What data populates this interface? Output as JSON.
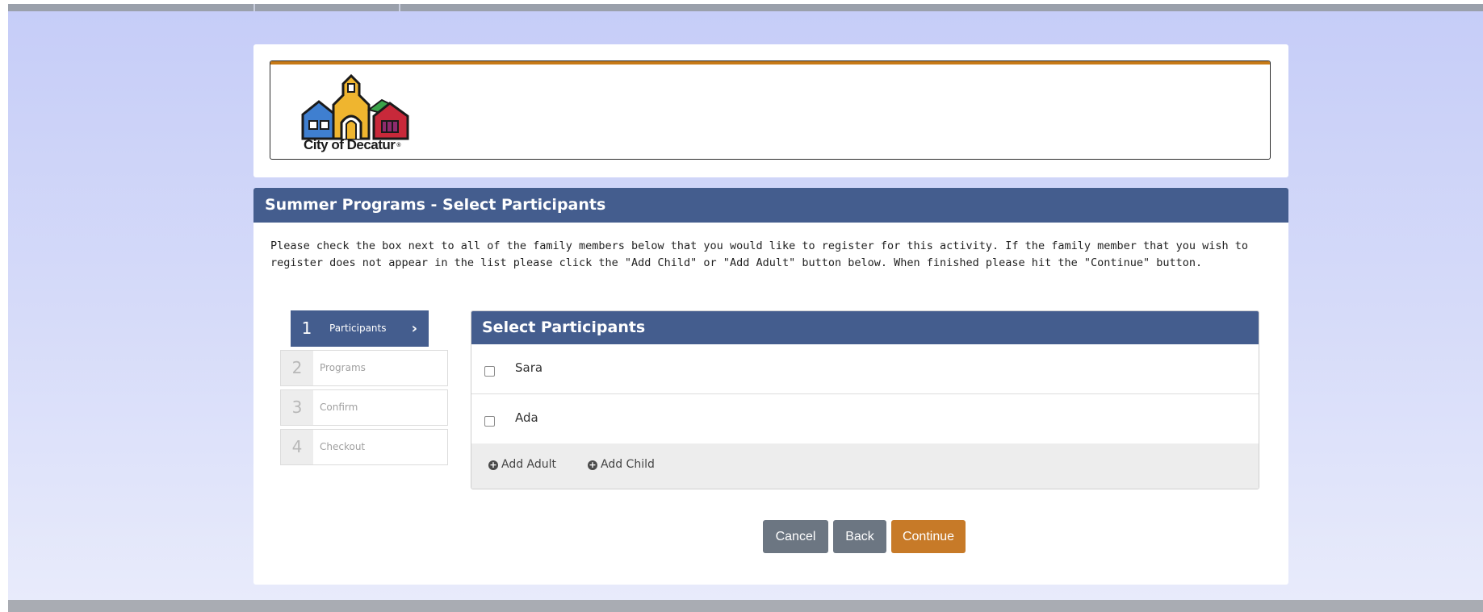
{
  "brand": {
    "logo_text": "City of Decatur",
    "accent_color": "#c77a17",
    "nav_color": "#445d8e"
  },
  "page": {
    "title": "Summer Programs - Select Participants",
    "instructions": "Please check the box next to all of the family members below that you would like to register for this activity. If the family member that you wish to register does not appear in the list please click the \"Add Child\" or \"Add Adult\" button below. When finished please hit the \"Continue\" button."
  },
  "steps": [
    {
      "num": "1",
      "label": "Participants",
      "active": true
    },
    {
      "num": "2",
      "label": "Programs",
      "active": false
    },
    {
      "num": "3",
      "label": "Confirm",
      "active": false
    },
    {
      "num": "4",
      "label": "Checkout",
      "active": false
    }
  ],
  "panel": {
    "title": "Select Participants",
    "participants": [
      {
        "name": "Sara",
        "checked": false
      },
      {
        "name": "Ada",
        "checked": false
      }
    ],
    "add_adult": "Add Adult",
    "add_child": "Add Child",
    "plus_icon": "plus-circle-icon"
  },
  "buttons": {
    "cancel": "Cancel",
    "back": "Back",
    "continue": "Continue"
  }
}
